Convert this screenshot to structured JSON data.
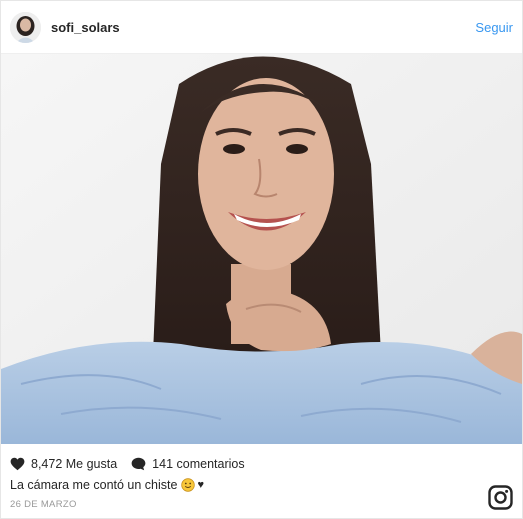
{
  "post": {
    "username": "sofi_solars",
    "follow_label": "Seguir",
    "likes": "8,472 Me gusta",
    "comments": "141 comentarios",
    "caption": "La cámara me contó un chiste",
    "caption_emoji": "slightly-smiling-face-icon",
    "caption_heart": "♥",
    "date": "26 DE MARZO"
  },
  "icons": {
    "like": "heart-icon",
    "comment": "speech-bubble-icon",
    "brand": "instagram-icon"
  },
  "colors": {
    "link": "#3897f0",
    "text": "#262626",
    "muted": "#999999"
  }
}
